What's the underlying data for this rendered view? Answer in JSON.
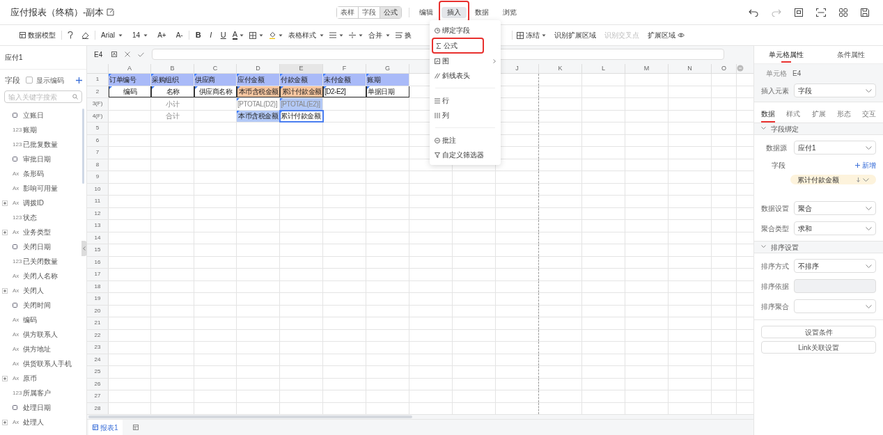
{
  "title": "应付报表（终稿）-副本",
  "view_modes": [
    {
      "label": "表样",
      "selected": false
    },
    {
      "label": "字段",
      "selected": false
    },
    {
      "label": "公式",
      "selected": true
    }
  ],
  "menus": [
    {
      "label": "编辑",
      "selected": false,
      "annotated": false
    },
    {
      "label": "插入",
      "selected": true,
      "annotated": true
    },
    {
      "label": "数据",
      "selected": false,
      "annotated": false
    },
    {
      "label": "浏览",
      "selected": false,
      "annotated": false
    }
  ],
  "toolbar": {
    "left": [
      [
        {
          "kind": "model",
          "label": "数据模型"
        }
      ],
      [
        {
          "kind": "painter"
        },
        {
          "kind": "eraser"
        }
      ],
      [
        {
          "kind": "dropdown",
          "label": "Arial"
        },
        {
          "kind": "dropdown",
          "label": "14"
        },
        {
          "kind": "text",
          "label": "A+"
        },
        {
          "kind": "text",
          "label": "A-"
        }
      ],
      [
        {
          "kind": "bold",
          "label": "B"
        },
        {
          "kind": "italic",
          "label": "I"
        },
        {
          "kind": "underline",
          "label": "U"
        },
        {
          "kind": "font-color",
          "label": "A"
        },
        {
          "kind": "border"
        },
        {
          "kind": "fill"
        },
        {
          "kind": "dropdown",
          "label": "表格样式"
        },
        {
          "kind": "align"
        },
        {
          "kind": "valign"
        },
        {
          "kind": "dropdown",
          "label": "合并"
        },
        {
          "kind": "wrap",
          "label": "换"
        }
      ]
    ],
    "right": [
      {
        "kind": "freeze",
        "label": "冻结"
      },
      {
        "kind": "text",
        "label": "识别扩展区域"
      },
      {
        "kind": "text",
        "label": "识别交叉点",
        "disabled": true
      },
      {
        "kind": "eye",
        "label": "扩展区域"
      }
    ]
  },
  "insert_menu": [
    {
      "kind": "bind",
      "label": "绑定字段",
      "annotated": false
    },
    {
      "kind": "sigma",
      "label": "公式",
      "annotated": true
    },
    {
      "kind": "chart",
      "label": "图",
      "annotated": false,
      "submenu": true
    },
    {
      "kind": "slash",
      "label": "斜线表头",
      "annotated": false
    },
    {
      "kind": "divider"
    },
    {
      "kind": "row",
      "label": "行",
      "annotated": false
    },
    {
      "kind": "col",
      "label": "列",
      "annotated": false
    },
    {
      "kind": "divider"
    },
    {
      "kind": "comment",
      "label": "批注",
      "annotated": false
    },
    {
      "kind": "filter",
      "label": "自定义筛选器",
      "annotated": false
    }
  ],
  "left_panel": {
    "dataset": "应付1",
    "fields_label": "字段",
    "show_code": {
      "label": "显示编码",
      "checked": false
    },
    "search": {
      "placeholder": "输入关键字搜索"
    },
    "fields": [
      {
        "label": "立账日",
        "expandable": false
      },
      {
        "type_mark": "123",
        "label": "账期",
        "expandable": false
      },
      {
        "type_mark": "123",
        "label": "已批复数量",
        "expandable": false
      },
      {
        "label": "审批日期",
        "expandable": false
      },
      {
        "type_mark": "Ax",
        "label": "条形码",
        "expandable": false
      },
      {
        "type_mark": "Ax",
        "label": "影响可用量",
        "expandable": false
      },
      {
        "type_mark": "Ax",
        "label": "调拨ID",
        "expandable": true
      },
      {
        "type_mark": "123",
        "label": "状态",
        "expandable": false
      },
      {
        "type_mark": "Ax",
        "label": "业务类型",
        "expandable": true
      },
      {
        "label": "关闭日期",
        "expandable": false
      },
      {
        "type_mark": "123",
        "label": "已关闭数量",
        "expandable": false
      },
      {
        "type_mark": "Ax",
        "label": "关闭人名称",
        "expandable": false
      },
      {
        "type_mark": "Ax",
        "label": "关闭人",
        "expandable": true
      },
      {
        "label": "关闭时间",
        "expandable": false
      },
      {
        "type_mark": "Ax",
        "label": "编码",
        "expandable": false
      },
      {
        "type_mark": "Ax",
        "label": "供方联系人",
        "expandable": false
      },
      {
        "type_mark": "Ax",
        "label": "供方地址",
        "expandable": false
      },
      {
        "type_mark": "Ax",
        "label": "供货联系人手机",
        "expandable": false
      },
      {
        "type_mark": "Ax",
        "label": "原币",
        "expandable": true
      },
      {
        "type_mark": "123",
        "label": "所属客户",
        "expandable": false
      },
      {
        "label": "处理日期",
        "expandable": false
      },
      {
        "type_mark": "Ax",
        "label": "处理人",
        "expandable": true
      }
    ]
  },
  "formula_bar": {
    "cell": "E4"
  },
  "columns": [
    {
      "label": "A",
      "selected": false
    },
    {
      "label": "B",
      "selected": false
    },
    {
      "label": "C",
      "selected": false
    },
    {
      "label": "D",
      "selected": false
    },
    {
      "label": "E",
      "selected": true
    },
    {
      "label": "F",
      "selected": false
    },
    {
      "label": "G",
      "selected": false
    },
    {},
    {},
    {
      "label": "J",
      "selected": false
    },
    {
      "label": "K",
      "selected": false
    },
    {
      "label": "L",
      "selected": false
    },
    {
      "label": "M",
      "selected": false
    },
    {
      "label": "N",
      "selected": false
    },
    {
      "label": "O",
      "selected": false
    }
  ],
  "rows": [
    {
      "label": "1",
      "cells": [
        {
          "text": "订单编号",
          "kind": "header",
          "centered": false,
          "marked": true
        },
        {
          "text": "采购组织",
          "kind": "header",
          "centered": false,
          "marked": true
        },
        {
          "text": "供应商",
          "kind": "header",
          "centered": false,
          "marked": true
        },
        {
          "text": "应付金额",
          "kind": "header",
          "centered": false,
          "marked": true
        },
        {
          "text": "付款金额",
          "kind": "header",
          "centered": false,
          "marked": true
        },
        {
          "text": "未付金额",
          "kind": "header",
          "centered": false,
          "marked": true
        },
        {
          "text": "账期",
          "kind": "header",
          "centered": false,
          "marked": true
        }
      ]
    },
    {
      "label": "2",
      "cells": [
        {
          "text": "编码",
          "kind": "plain",
          "centered": true,
          "marked": true,
          "bordered": true
        },
        {
          "text": "名称",
          "kind": "plain",
          "centered": true,
          "marked": true,
          "bordered": true
        },
        {
          "text": "供应商名称",
          "kind": "plain",
          "centered": true,
          "marked": true,
          "bordered": true
        },
        {
          "text": "本币含税金额",
          "kind": "orange",
          "centered": true,
          "marked": true,
          "bordered": true
        },
        {
          "text": "累计付款金额",
          "kind": "orange",
          "centered": true,
          "marked": true,
          "bordered": true
        },
        {
          "text": "[D2-E2]",
          "kind": "plain",
          "centered": false,
          "marked": true,
          "bordered": true
        },
        {
          "text": "单据日期",
          "kind": "plain",
          "centered": false,
          "marked": true,
          "bordered": true
        }
      ]
    },
    {
      "label": "3(F)",
      "cells": [
        {
          "kind": "plain"
        },
        {
          "text": "小计",
          "kind": "plain",
          "centered": true,
          "muted": true
        },
        {
          "kind": "plain"
        },
        {
          "text": "[PTOTAL(D2)]",
          "kind": "plain",
          "centered": false,
          "marked": true,
          "muted": true
        },
        {
          "text": "[PTOTAL(E2)]",
          "kind": "blue",
          "centered": false,
          "marked": true,
          "muted": true
        }
      ]
    },
    {
      "label": "4(F)",
      "cells": [
        {
          "kind": "plain"
        },
        {
          "text": "合计",
          "kind": "plain",
          "centered": true,
          "muted": true
        },
        {
          "kind": "plain"
        },
        {
          "text": "本币含税金额",
          "kind": "blue",
          "centered": true,
          "marked": true
        },
        {
          "text": "累计付款金额",
          "kind": "plain",
          "centered": false,
          "marked": true,
          "selected": true
        }
      ]
    },
    {
      "label": "5"
    },
    {
      "label": "6"
    },
    {
      "label": "7"
    },
    {
      "label": "8"
    },
    {
      "label": "9"
    },
    {
      "label": "10"
    },
    {
      "label": "11"
    },
    {
      "label": "12"
    },
    {
      "label": "13"
    },
    {
      "label": "14"
    },
    {
      "label": "15"
    },
    {
      "label": "16"
    },
    {
      "label": "17"
    },
    {
      "label": "18"
    },
    {
      "label": "19"
    },
    {
      "label": "20"
    },
    {
      "label": "21"
    },
    {
      "label": "22"
    },
    {
      "label": "23"
    },
    {
      "label": "24"
    },
    {
      "label": "25"
    },
    {
      "label": "26"
    },
    {
      "label": "27"
    },
    {
      "label": "28"
    }
  ],
  "sheets": [
    {
      "label": "报表1",
      "selected": true
    }
  ],
  "right_panel": {
    "tabs": [
      {
        "label": "单元格属性",
        "selected": true
      },
      {
        "label": "条件属性",
        "selected": false
      }
    ],
    "cell": {
      "label": "单元格",
      "value": "E4"
    },
    "insert_element": {
      "label": "插入元素",
      "value": "字段"
    },
    "subtabs": [
      {
        "label": "数据",
        "selected": true
      },
      {
        "label": "样式",
        "selected": false
      },
      {
        "label": "扩展",
        "selected": false
      },
      {
        "label": "形态",
        "selected": false
      },
      {
        "label": "交互",
        "selected": false
      }
    ],
    "binding": {
      "title": "字段绑定",
      "expanded": true,
      "source": {
        "label": "数据源",
        "value": "应付1"
      },
      "field_label": "字段",
      "add": "新增",
      "chip": "累计付款金额",
      "data_setting": {
        "label": "数据设置",
        "value": "聚合"
      },
      "agg_type": {
        "label": "聚合类型",
        "value": "求和"
      }
    },
    "sort": {
      "title": "排序设置",
      "expanded": true,
      "method": {
        "label": "排序方式",
        "value": "不排序"
      },
      "basis": {
        "label": "排序依据",
        "disabled": true
      },
      "agg": {
        "label": "排序聚合"
      }
    },
    "buttons": [
      "设置条件",
      "Link关联设置"
    ]
  }
}
